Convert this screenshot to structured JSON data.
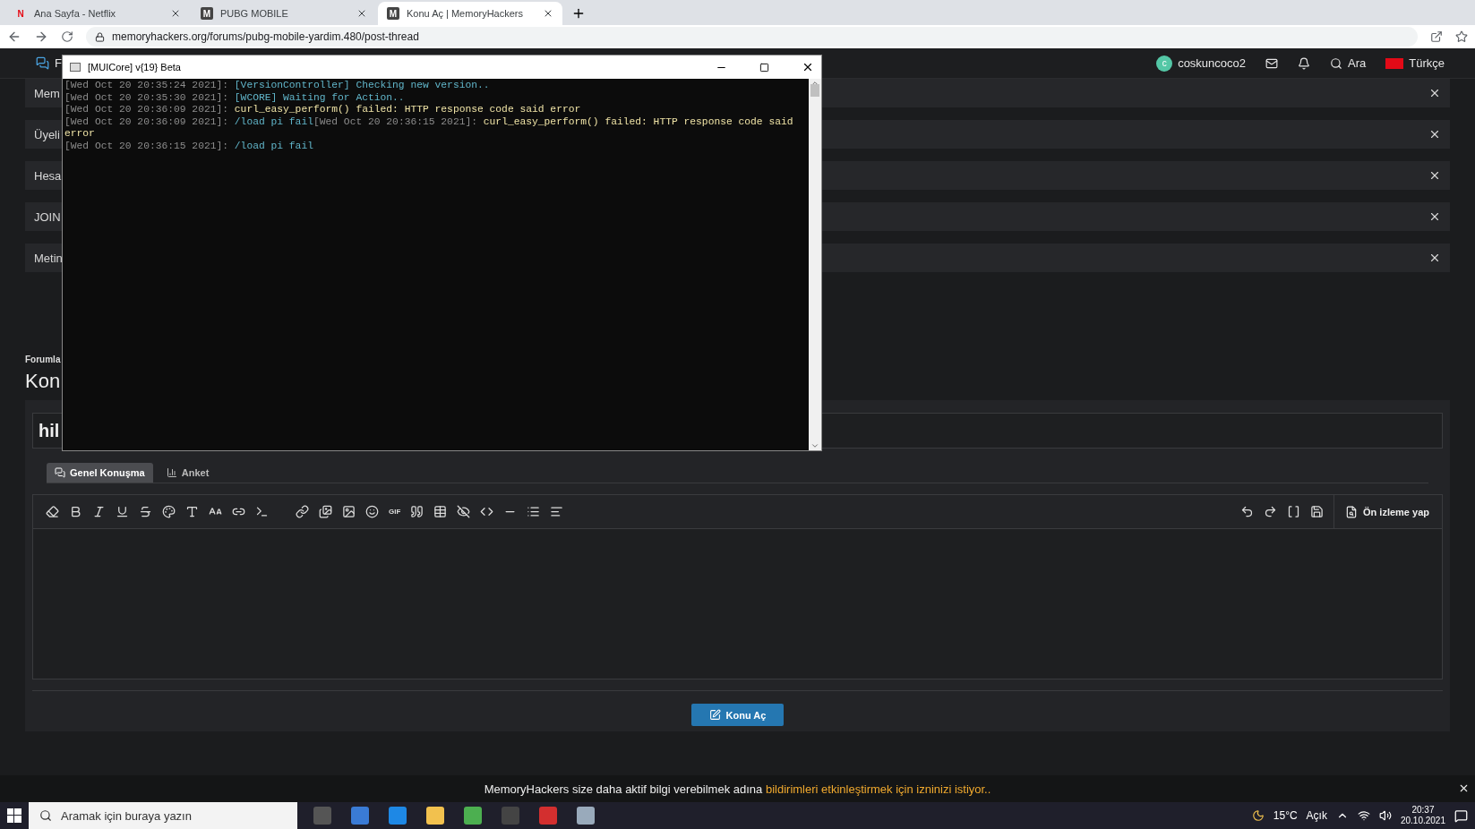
{
  "browser": {
    "tabs": [
      {
        "title": "Ana Sayfa - Netflix",
        "kind": "netflix",
        "favicon": "N",
        "selected": false
      },
      {
        "title": "PUBG MOBILE",
        "kind": "site",
        "favicon": "M",
        "selected": false
      },
      {
        "title": "Konu Aç | MemoryHackers",
        "kind": "site",
        "favicon": "M",
        "selected": true
      }
    ],
    "url": "memoryhackers.org/forums/pubg-mobile-yardim.480/post-thread"
  },
  "site_nav": {
    "logo": "F",
    "user": "coskuncoco2",
    "avatar_letter": "c",
    "search": "Ara",
    "language": "Türkçe"
  },
  "notices": [
    {
      "text": "Mem"
    },
    {
      "text": "Üyeli"
    },
    {
      "text": "Hesa"
    },
    {
      "text": "JOIN"
    },
    {
      "text": "Metin"
    }
  ],
  "breadcrumb": "Forumla",
  "page_title": "Kon",
  "thread_title": "hil",
  "editor_tabs": [
    {
      "label": "Genel Konuşma",
      "kind": "chat",
      "selected": true
    },
    {
      "label": "Anket",
      "kind": "poll",
      "selected": false
    }
  ],
  "toolbar": {
    "gif_label": "GIF",
    "preview": "Ön izleme yap"
  },
  "submit": "Konu Aç",
  "push_notice": {
    "text": "MemoryHackers size daha aktif bilgi verebilmek adına ",
    "link": "bildirimleri etkinleştirmek için izninizi istiyor.."
  },
  "console": {
    "title": "[MUICore] v{19} Beta",
    "lines": [
      {
        "segments": [
          {
            "text": "[Wed Oct 20 20:35:24 2021]: ",
            "kind": "time"
          },
          {
            "text": "[VersionController] Checking new version..",
            "kind": "info"
          }
        ]
      },
      {
        "segments": [
          {
            "text": "[Wed Oct 20 20:35:30 2021]: ",
            "kind": "time"
          },
          {
            "text": "[WCORE] Waiting for Action..",
            "kind": "info"
          }
        ]
      },
      {
        "segments": [
          {
            "text": "[Wed Oct 20 20:36:09 2021]: ",
            "kind": "time"
          },
          {
            "text": "curl_easy_perform() failed: HTTP response code said error",
            "kind": "error"
          }
        ]
      },
      {
        "segments": [
          {
            "text": "[Wed Oct 20 20:36:09 2021]: ",
            "kind": "time"
          },
          {
            "text": "/load pi fail",
            "kind": "info"
          },
          {
            "text": "[Wed Oct 20 20:36:15 2021]: ",
            "kind": "time"
          },
          {
            "text": "curl_easy_perform() failed: HTTP response code said error",
            "kind": "error"
          }
        ]
      },
      {
        "segments": [
          {
            "text": "[Wed Oct 20 20:36:15 2021]: ",
            "kind": "time"
          },
          {
            "text": "/load pi fail",
            "kind": "info"
          }
        ]
      }
    ]
  },
  "taskbar": {
    "search_placeholder": "Aramak için buraya yazın",
    "weather": "15°C",
    "condition": "Açık",
    "time": "20:37",
    "date": "20.10.2021"
  }
}
